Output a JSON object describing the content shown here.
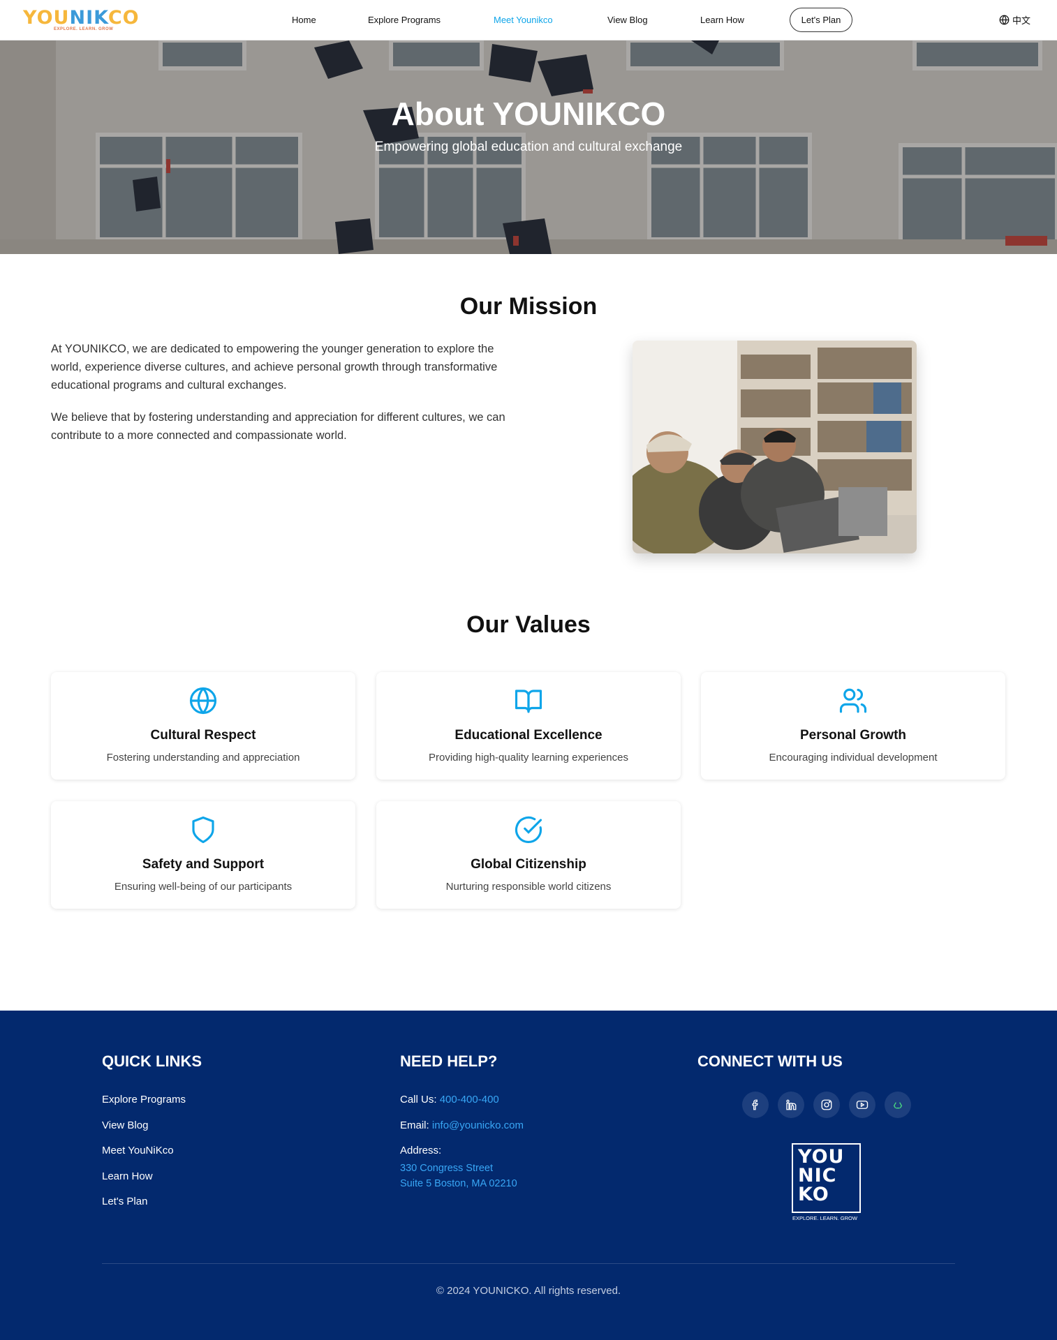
{
  "brand": {
    "logo_part1": "YOU",
    "logo_part2": "NIK",
    "logo_part3": "CO",
    "tagline": "EXPLORE. LEARN. GROW",
    "accent": "#0ea5e9",
    "logo_yellow": "#f6b73c",
    "logo_blue": "#3b9ad9"
  },
  "nav": {
    "items": [
      {
        "label": "Home",
        "active": false
      },
      {
        "label": "Explore Programs",
        "active": false
      },
      {
        "label": "Meet Younikco",
        "active": true
      },
      {
        "label": "View Blog",
        "active": false
      },
      {
        "label": "Learn How",
        "active": false
      }
    ],
    "cta": "Let's Plan",
    "language": "中文",
    "language_icon": "globe-icon"
  },
  "hero": {
    "title": "About YOUNIKCO",
    "subtitle": "Empowering global education and cultural exchange"
  },
  "mission": {
    "title": "Our Mission",
    "paragraphs": [
      "At YOUNIKCO, we are dedicated to empowering the younger generation to explore the world, experience diverse cultures, and achieve personal growth through transformative educational programs and cultural exchanges.",
      "We believe that by fostering understanding and appreciation for different cultures, we can contribute to a more connected and compassionate world."
    ]
  },
  "values": {
    "title": "Our Values",
    "items": [
      {
        "icon": "globe-icon",
        "title": "Cultural Respect",
        "desc": "Fostering understanding and appreciation"
      },
      {
        "icon": "book-open-icon",
        "title": "Educational Excellence",
        "desc": "Providing high-quality learning experiences"
      },
      {
        "icon": "users-icon",
        "title": "Personal Growth",
        "desc": "Encouraging individual development"
      },
      {
        "icon": "shield-icon",
        "title": "Safety and Support",
        "desc": "Ensuring well-being of our participants"
      },
      {
        "icon": "check-circle-icon",
        "title": "Global Citizenship",
        "desc": "Nurturing responsible world citizens"
      }
    ],
    "icon_color": "#0ea5e9"
  },
  "footer": {
    "bg": "#03296e",
    "quick_links": {
      "title": "QUICK LINKS",
      "items": [
        "Explore Programs",
        "View Blog",
        "Meet YouNiKco",
        "Learn How",
        "Let's Plan"
      ]
    },
    "help": {
      "title": "NEED HELP?",
      "call_label": "Call Us:",
      "call_value": "400-400-400",
      "email_label": "Email:",
      "email_value": "info@younicko.com",
      "address_label": "Address:",
      "address_line1": "330 Congress Street",
      "address_line2": "Suite 5 Boston, MA 02210"
    },
    "connect": {
      "title": "CONNECT WITH US",
      "socials": [
        "facebook-icon",
        "linkedin-icon",
        "instagram-icon",
        "youtube-icon",
        "wechat-icon"
      ],
      "logo_line1": "YOU",
      "logo_line2": "NIC",
      "logo_line3": "KO",
      "logo_tagline": "EXPLORE. LEARN. GROW"
    },
    "copyright": "© 2024 YOUNICKO. All rights reserved."
  }
}
